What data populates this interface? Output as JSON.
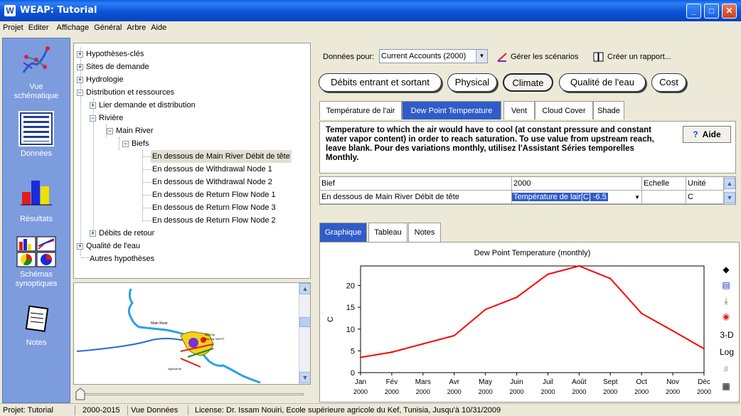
{
  "window": {
    "title": "WEAP: Tutorial",
    "app_icon_letter": "W"
  },
  "menu": [
    "Projet",
    "Editer",
    "Affichage",
    "Général",
    "Arbre",
    "Aide"
  ],
  "leftnav": [
    {
      "label1": "Vue",
      "label2": "schématique"
    },
    {
      "label1": "Données",
      "label2": ""
    },
    {
      "label1": "Résultats",
      "label2": ""
    },
    {
      "label1": "Schémas",
      "label2": "synoptiques"
    },
    {
      "label1": "Notes",
      "label2": ""
    }
  ],
  "tree": [
    {
      "label": "Hypothèses-clés",
      "expander": "+"
    },
    {
      "label": "Sites de demande",
      "expander": "+"
    },
    {
      "label": "Hydrologie",
      "expander": "+"
    },
    {
      "label": "Distribution et ressources",
      "expander": "−"
    },
    {
      "label": "Lier demande et distribution",
      "expander": "+"
    },
    {
      "label": "Rivière",
      "expander": "−"
    },
    {
      "label": "Main River",
      "expander": "−"
    },
    {
      "label": "Biefs",
      "expander": "−"
    },
    {
      "label": "En dessous de Main River Débit de tête",
      "expander": ""
    },
    {
      "label": "En dessous de Withdrawal Node 1",
      "expander": ""
    },
    {
      "label": "En dessous de Withdrawal Node 2",
      "expander": ""
    },
    {
      "label": "En dessous de Return Flow Node 1",
      "expander": ""
    },
    {
      "label": "En dessous de Return Flow Node 3",
      "expander": ""
    },
    {
      "label": "En dessous de Return Flow Node 2",
      "expander": ""
    },
    {
      "label": "Débits de retour",
      "expander": "+"
    },
    {
      "label": "Qualité de l'eau",
      "expander": "+"
    },
    {
      "label": "Autres hypothèses",
      "expander": ""
    }
  ],
  "map": {
    "labels": [
      "Main River",
      "Big City",
      "Big City WWTP",
      "Agriculture"
    ]
  },
  "toolbar": {
    "data_for_label": "Données pour:",
    "scenario_value": "Current Accounts (2000)",
    "manage_scenarios": "Gérer les scénarios",
    "create_report": "Créer un rapport..."
  },
  "category_tabs": [
    "Débits entrant et sortant",
    "Physical",
    "Climate",
    "Qualité de l'eau",
    "Cost"
  ],
  "sub_tabs": [
    "Température de l'air",
    "Dew Point Temperature",
    "Vent",
    "Cloud Cover",
    "Shade"
  ],
  "description": "Temperature to which the air would have to cool (at constant pressure and constant water vapor content) in order to reach saturation.  To use value from upstream reach, leave blank.  Pour des variations monthly, utilisez l'Assistant Séries temporelles Monthly.",
  "help_button": "Aide",
  "grid": {
    "headers": [
      "Bief",
      "2000",
      "Echelle",
      "Unité"
    ],
    "row": [
      "En dessous de Main River Débit de tête",
      "Température de lair[C] -6.5",
      "",
      "C"
    ]
  },
  "bottom_tabs": [
    "Graphique",
    "Tableau",
    "Notes"
  ],
  "side_icons": [
    "3-D",
    "Log"
  ],
  "chart_data": {
    "type": "line",
    "title": "Dew Point Temperature (monthly)",
    "ylabel": "C",
    "xlabel": "",
    "categories": [
      "Jan\n2000",
      "Fév\n2000",
      "Mars\n2000",
      "Avr\n2000",
      "May\n2000",
      "Juin\n2000",
      "Juil\n2000",
      "Août\n2000",
      "Sept\n2000",
      "Oct\n2000",
      "Nov\n2000",
      "Déc\n2000"
    ],
    "cat_top": [
      "Jan",
      "Fév",
      "Mars",
      "Avr",
      "May",
      "Juin",
      "Juil",
      "Août",
      "Sept",
      "Oct",
      "Nov",
      "Déc"
    ],
    "cat_bottom": "2000",
    "values": [
      3.5,
      4.7,
      6.6,
      8.5,
      14.5,
      17.3,
      22.6,
      24.5,
      21.6,
      13.6,
      9.6,
      5.5
    ],
    "ylim": [
      0,
      24.5
    ],
    "yticks": [
      0,
      5,
      10,
      15,
      20
    ],
    "color": "#ff0000",
    "grid": false
  },
  "status": {
    "project": "Projet: Tutorial",
    "years": "2000-2015",
    "view": "Vue Données",
    "license": "License: Dr. Issam Nouiri, Ecole supérieure agricole du Kef, Tunisia, Jusqu'à 10/31/2009"
  }
}
